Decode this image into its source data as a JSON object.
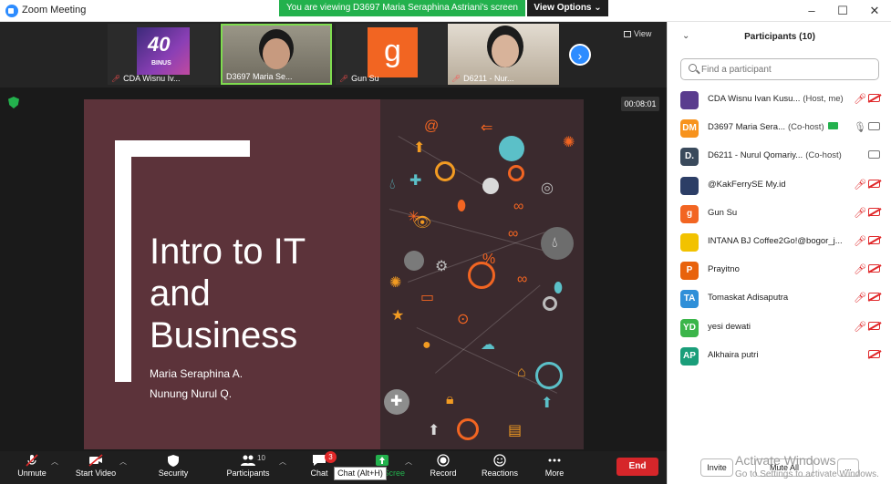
{
  "window": {
    "title": "Zoom Meeting",
    "share_banner": "You are viewing D3697 Maria Seraphina Astriani's screen",
    "view_options_label": "View Options",
    "controls": [
      "–",
      "☐",
      "✕"
    ]
  },
  "gallery": {
    "tiles": [
      {
        "name": "CDA Wisnu Iv...",
        "art_text": "40",
        "art_sub": "BINUS",
        "muted": true
      },
      {
        "name": "D3697 Maria Se...",
        "muted": false
      },
      {
        "name": "Gun Su",
        "letter": "g",
        "muted": true
      },
      {
        "name": "D6211 - Nur...",
        "muted": true
      }
    ],
    "view_label": "View",
    "timer": "00:08:01"
  },
  "slide": {
    "title": "Intro to IT and Business",
    "authors": [
      "Maria Seraphina A.",
      "Nunung Nurul Q."
    ]
  },
  "toolbar": {
    "unmute": "Unmute",
    "start_video": "Start Video",
    "security": "Security",
    "participants": "Participants",
    "participants_count": "10",
    "chat": "Chat",
    "chat_badge": "3",
    "share_screen": "Share Screen",
    "record": "Record",
    "reactions": "Reactions",
    "more": "More",
    "end": "End",
    "tooltip": "Chat (Alt+H)"
  },
  "participants_panel": {
    "title": "Participants (10)",
    "search_placeholder": "Find a participant",
    "participants": [
      {
        "initials": "",
        "name": "CDA Wisnu Ivan Kusu...",
        "role": "(Host, me)",
        "color": "#5a3c8e",
        "mic": "muted",
        "cam": "off"
      },
      {
        "initials": "DM",
        "name": "D3697 Maria Sera...",
        "role": "(Co-host)",
        "color": "#f7931e",
        "mic": "on",
        "cam": "on",
        "sharing": true
      },
      {
        "initials": "D.",
        "name": "D6211 - Nurul Qomariy...",
        "role": "(Co-host)",
        "color": "#3a4a5c",
        "mic": "none",
        "cam": "on"
      },
      {
        "initials": "",
        "name": "@KakFerrySE My.id",
        "role": "",
        "color": "#2c3e66",
        "mic": "muted",
        "cam": "off"
      },
      {
        "initials": "g",
        "name": "Gun Su",
        "role": "",
        "color": "#f26522",
        "mic": "muted",
        "cam": "off"
      },
      {
        "initials": "",
        "name": "INTANA BJ Coffee2Go!@bogor_j...",
        "role": "",
        "color": "#f2c200",
        "mic": "muted",
        "cam": "off"
      },
      {
        "initials": "P",
        "name": "Prayitno",
        "role": "",
        "color": "#e8620c",
        "mic": "muted",
        "cam": "off"
      },
      {
        "initials": "TA",
        "name": "Tomaskat Adisaputra",
        "role": "",
        "color": "#2f8fd8",
        "mic": "muted",
        "cam": "off"
      },
      {
        "initials": "YD",
        "name": "yesi dewati",
        "role": "",
        "color": "#3bb54a",
        "mic": "muted",
        "cam": "off"
      },
      {
        "initials": "AP",
        "name": "Alkhaira putri",
        "role": "",
        "color": "#1a9e7a",
        "mic": "none",
        "cam": "off"
      }
    ],
    "invite_label": "Invite",
    "mute_all_label": "Mute All",
    "more_label": "..."
  },
  "os_watermark": {
    "line1": "Activate Windows",
    "line2": "Go to Settings to activate Windows."
  },
  "colors": {
    "accent_blue": "#2d8cff",
    "share_green": "#23b14d",
    "end_red": "#d6262a",
    "slide_bg": "#5c333a"
  }
}
